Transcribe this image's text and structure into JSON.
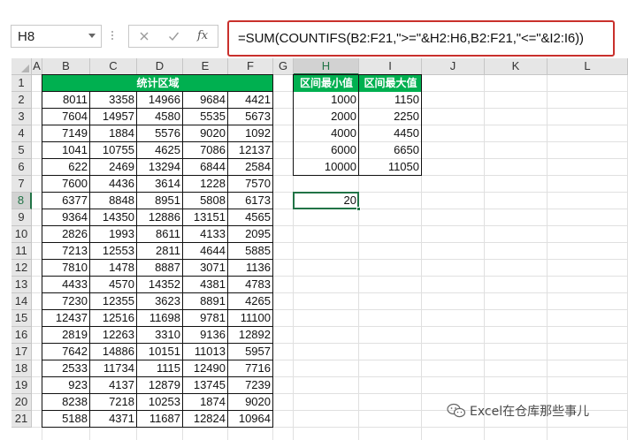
{
  "formula_bar": {
    "name_box": "H8",
    "formula": "=SUM(COUNTIFS(B2:F21,\">=\"&H2:H6,B2:F21,\"<=\"&I2:I6))",
    "fx_label": "fx"
  },
  "sheet": {
    "columns": [
      "A",
      "B",
      "C",
      "D",
      "E",
      "F",
      "G",
      "H",
      "I",
      "J",
      "K",
      "L"
    ],
    "selected_column": "H",
    "rows": [
      "1",
      "2",
      "3",
      "4",
      "5",
      "6",
      "7",
      "8",
      "9",
      "10",
      "11",
      "12",
      "13",
      "14",
      "15",
      "16",
      "17",
      "18",
      "19",
      "20",
      "21"
    ],
    "selected_row": "8",
    "stats_header": "统计区域",
    "stats_data": [
      [
        "8011",
        "3358",
        "14966",
        "9684",
        "4421"
      ],
      [
        "7604",
        "14957",
        "4580",
        "5535",
        "5673"
      ],
      [
        "7149",
        "1884",
        "5576",
        "9020",
        "1092"
      ],
      [
        "1041",
        "10755",
        "4625",
        "7086",
        "12137"
      ],
      [
        "622",
        "2469",
        "13294",
        "6844",
        "2584"
      ],
      [
        "7600",
        "4436",
        "3614",
        "1228",
        "7570"
      ],
      [
        "6377",
        "8848",
        "8951",
        "5808",
        "6173"
      ],
      [
        "9364",
        "14350",
        "12886",
        "13151",
        "4565"
      ],
      [
        "2826",
        "1993",
        "8611",
        "4133",
        "2095"
      ],
      [
        "7213",
        "12553",
        "2811",
        "4644",
        "5885"
      ],
      [
        "7810",
        "1478",
        "8887",
        "3071",
        "1136"
      ],
      [
        "4433",
        "4570",
        "14352",
        "4381",
        "4783"
      ],
      [
        "7230",
        "12355",
        "3623",
        "8891",
        "4265"
      ],
      [
        "12437",
        "12516",
        "11698",
        "9781",
        "11100"
      ],
      [
        "2819",
        "12263",
        "3310",
        "9136",
        "12892"
      ],
      [
        "7642",
        "14886",
        "10151",
        "11013",
        "5957"
      ],
      [
        "2533",
        "11734",
        "1115",
        "12490",
        "7716"
      ],
      [
        "923",
        "4137",
        "12879",
        "13745",
        "7239"
      ],
      [
        "8238",
        "7218",
        "10253",
        "1874",
        "9020"
      ],
      [
        "5188",
        "4371",
        "11687",
        "12824",
        "10964"
      ]
    ],
    "range_headers": [
      "区间最小值",
      "区间最大值"
    ],
    "range_data": [
      [
        "1000",
        "1150"
      ],
      [
        "2000",
        "2250"
      ],
      [
        "4000",
        "4450"
      ],
      [
        "6000",
        "6650"
      ],
      [
        "10000",
        "11050"
      ]
    ],
    "result_value": "20"
  },
  "watermark": "Excel在仓库那些事儿",
  "colors": {
    "header_green": "#00b050",
    "excel_green": "#217346",
    "highlight_red": "#c9302c"
  }
}
